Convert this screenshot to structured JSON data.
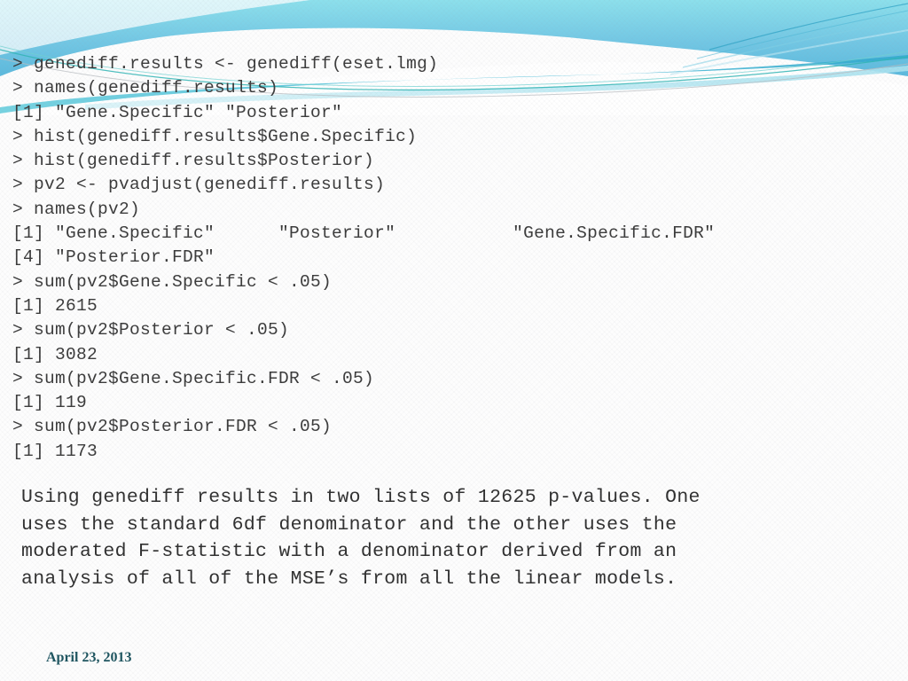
{
  "slide": {
    "theme_accent": "#4ec3d9",
    "theme_accent_dark": "#18a0b8",
    "background": "#fdfdfd",
    "footer_text_color": "#1f5560"
  },
  "header": {
    "decoration_name": "wave-swoosh-banner"
  },
  "console": {
    "lines": [
      "> genediff.results <- genediff(eset.lmg)",
      "> names(genediff.results)",
      "[1] \"Gene.Specific\" \"Posterior\"",
      "> hist(genediff.results$Gene.Specific)",
      "> hist(genediff.results$Posterior)",
      "> pv2 <- pvadjust(genediff.results)",
      "> names(pv2)",
      "[1] \"Gene.Specific\"      \"Posterior\"           \"Gene.Specific.FDR\"",
      "[4] \"Posterior.FDR\"",
      "> sum(pv2$Gene.Specific < .05)",
      "[1] 2615",
      "> sum(pv2$Posterior < .05)",
      "[1] 3082",
      "> sum(pv2$Gene.Specific.FDR < .05)",
      "[1] 119",
      "> sum(pv2$Posterior.FDR < .05)",
      "[1] 1173"
    ]
  },
  "narrative": {
    "lines": [
      "Using genediff results in two lists of 12625 p-values. One",
      "uses the standard 6df denominator and the other uses the",
      "moderated F-statistic with a denominator derived from an",
      "analysis of all of the MSE’s from all the linear models."
    ]
  },
  "footer": {
    "date": "April 23, 2013"
  }
}
